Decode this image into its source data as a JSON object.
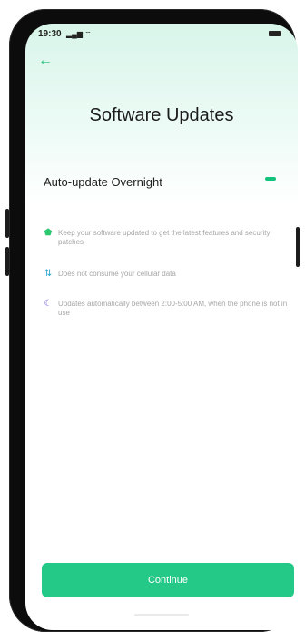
{
  "status_bar": {
    "time": "19:30",
    "signal_icon": "signal-icon",
    "wifi_icon": "wifi-icon",
    "battery_icon": "battery-icon"
  },
  "header": {
    "back_icon": "arrow-left-icon",
    "back_glyph": "←",
    "title": "Software Updates"
  },
  "setting": {
    "label": "Auto-update Overnight",
    "toggle_icon": "minus-icon"
  },
  "info": [
    {
      "icon": "shield-icon",
      "glyph": "⬟",
      "color": "#2cc76f",
      "text": "Keep your software updated to get the latest features and security patches"
    },
    {
      "icon": "arrows-up-down-icon",
      "glyph": "⇅",
      "color": "#2aa6d1",
      "text": "Does not consume your cellular data"
    },
    {
      "icon": "moon-icon",
      "glyph": "☾",
      "color": "#6b4fe0",
      "text": "Updates automatically between 2:00-5:00 AM, when the phone is not in use"
    }
  ],
  "footer": {
    "continue_label": "Continue"
  },
  "colors": {
    "accent": "#25c987"
  }
}
